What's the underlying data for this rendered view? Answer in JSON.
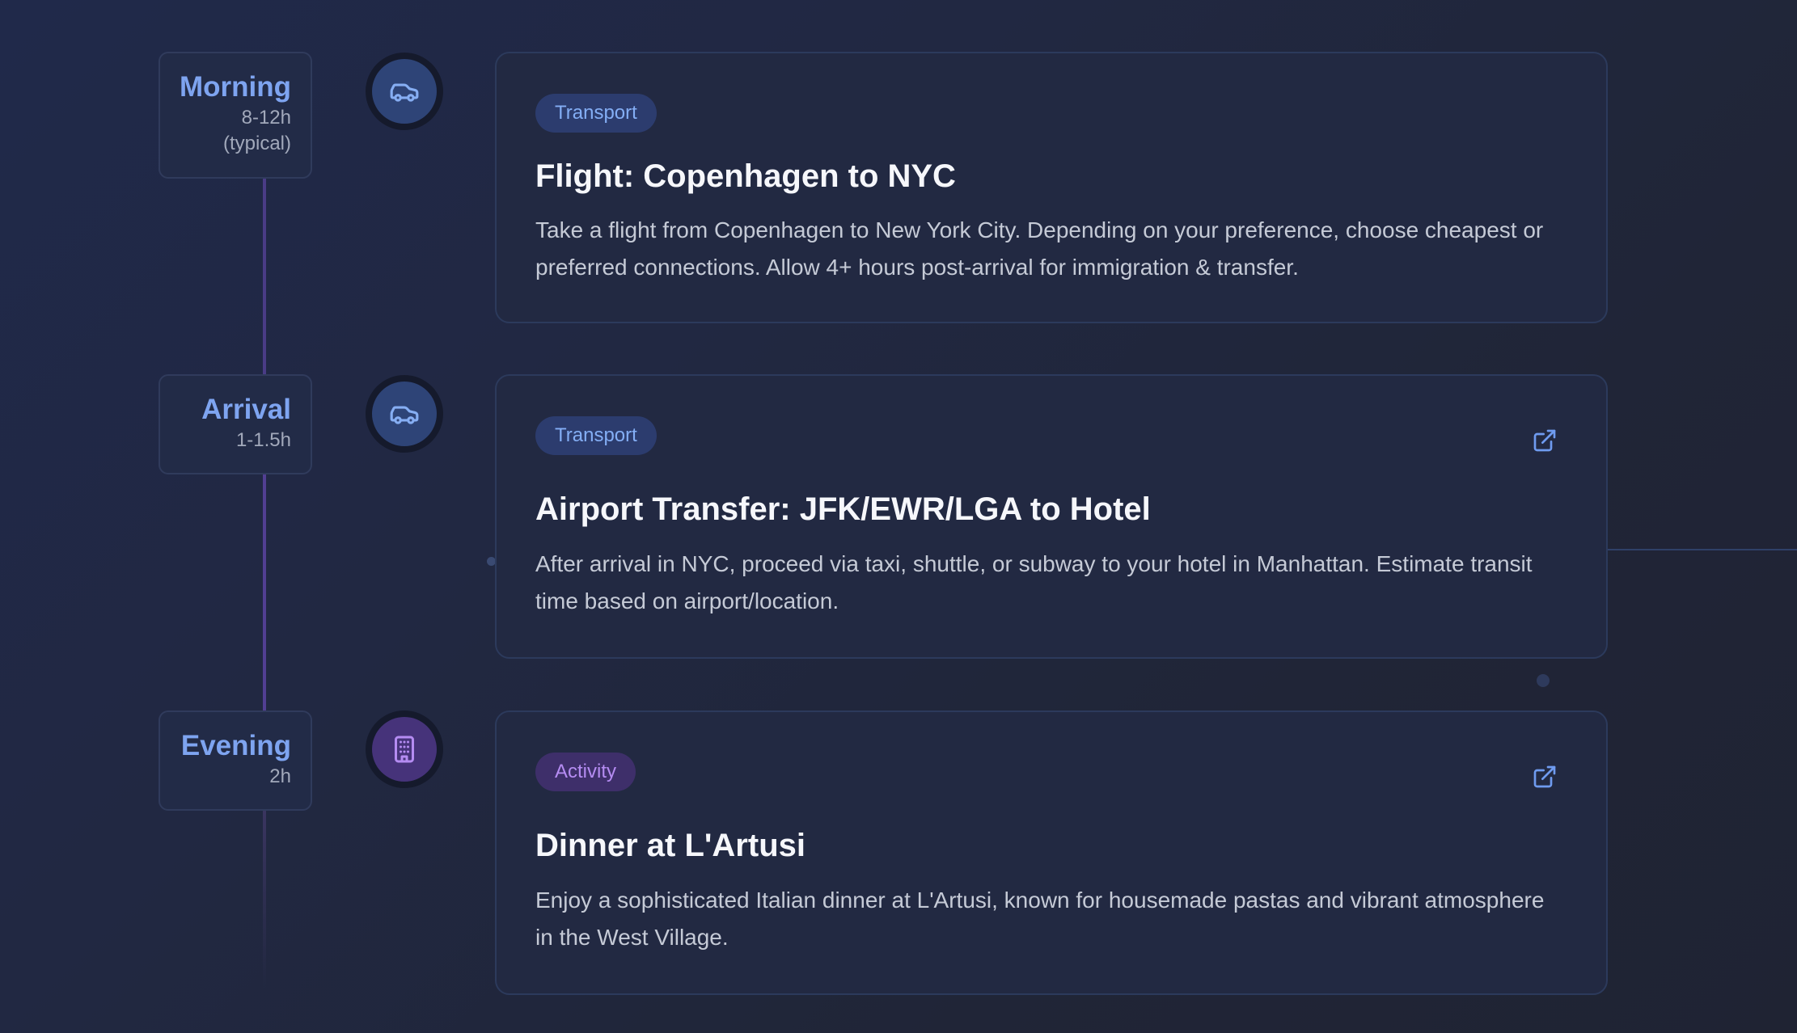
{
  "items": [
    {
      "time_label": "Morning",
      "duration_line1": "8-12h",
      "duration_line2": "(typical)",
      "icon": "car-icon",
      "category": "Transport",
      "title": "Flight: Copenhagen to NYC",
      "description": "Take a flight from Copenhagen to New York City. Depending on your preference, choose cheapest or preferred connections. Allow 4+ hours post-arrival for immigration & transfer.",
      "has_link": false
    },
    {
      "time_label": "Arrival",
      "duration_line1": "1-1.5h",
      "icon": "car-icon",
      "category": "Transport",
      "title": "Airport Transfer: JFK/EWR/LGA to Hotel",
      "description": "After arrival in NYC, proceed via taxi, shuttle, or subway to your hotel in Manhattan. Estimate transit time based on airport/location.",
      "has_link": true,
      "link_icon": "external-link-icon"
    },
    {
      "time_label": "Evening",
      "duration_line1": "2h",
      "icon": "building-icon",
      "category": "Activity",
      "title": "Dinner at L'Artusi",
      "description": "Enjoy a sophisticated Italian dinner at L'Artusi, known for housemade pastas and vibrant atmosphere in the West Village.",
      "has_link": true,
      "link_icon": "external-link-icon"
    }
  ],
  "colors": {
    "time_label": "#7ea4f0",
    "transport_tag_bg": "#2c3c6e",
    "transport_tag_text": "#84aef5",
    "activity_tag_bg": "#3e2f6a",
    "activity_tag_text": "#b58cf2",
    "timeline_line": "#4a3c86"
  }
}
